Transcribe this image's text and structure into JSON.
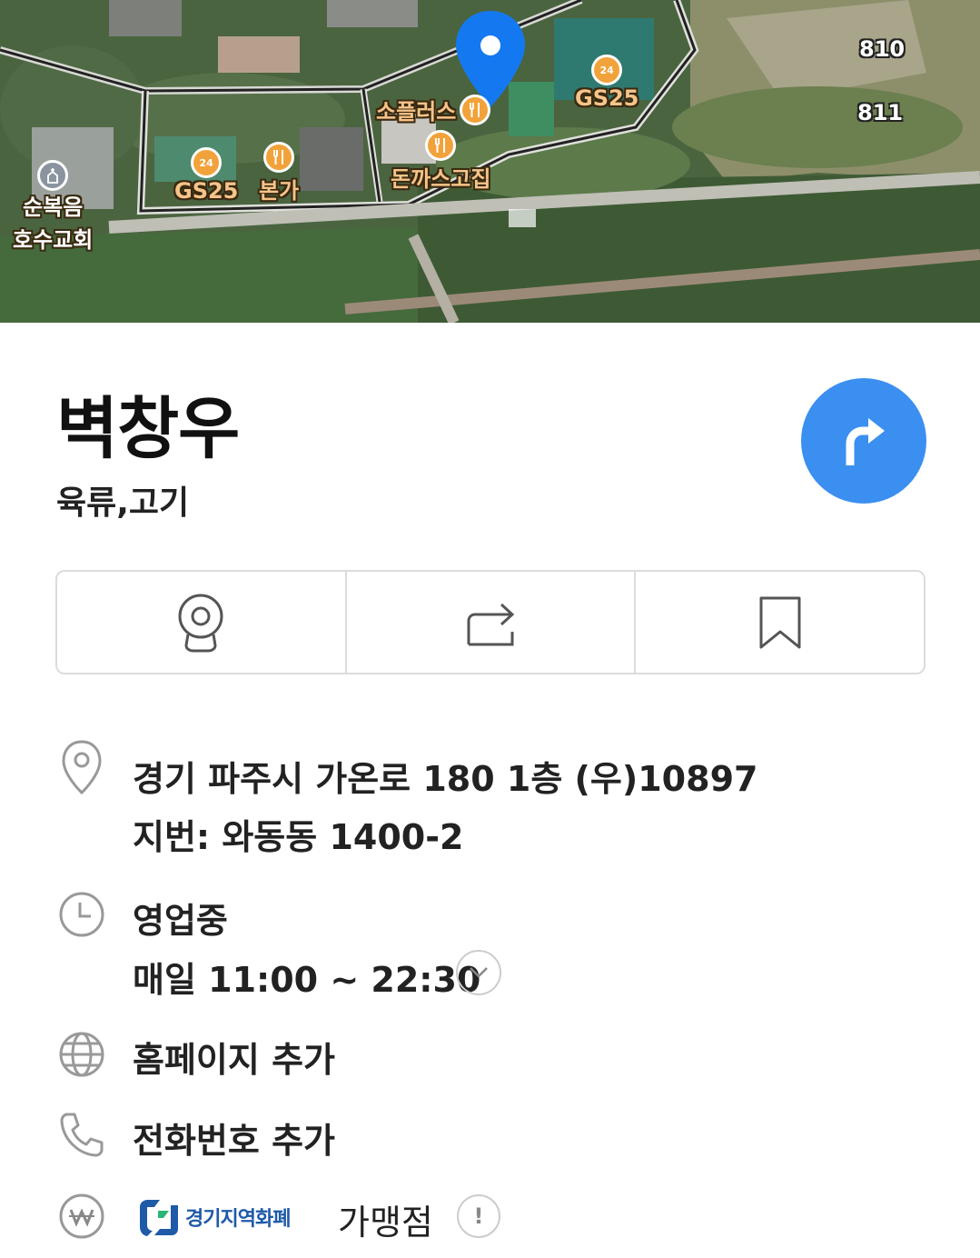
{
  "map": {
    "pois": [
      {
        "name": "소플러스",
        "icon": "restaurant-icon"
      },
      {
        "name": "GS25",
        "icon": "convenience-store-icon",
        "badge": "24"
      },
      {
        "name": "돈까스고집",
        "icon": "restaurant-icon"
      },
      {
        "name": "GS25",
        "icon": "convenience-store-icon",
        "badge": "24"
      },
      {
        "name": "본가",
        "icon": "restaurant-icon"
      },
      {
        "name": "순복음\n호수교회",
        "icon": "church-icon"
      }
    ],
    "road_numbers": [
      "810",
      "811"
    ]
  },
  "place": {
    "name": "벽창우",
    "category": "육류,고기"
  },
  "actions": {
    "items": [
      {
        "icon": "street-view-icon"
      },
      {
        "icon": "share-icon"
      },
      {
        "icon": "bookmark-icon"
      }
    ]
  },
  "info": {
    "address": "경기 파주시 가온로 180 1층 (우)10897",
    "lot_address": "지번: 와동동 1400-2",
    "status": "영업중",
    "hours": "매일 11:00 ~ 22:30",
    "homepage": "홈페이지 추가",
    "phone": "전화번호 추가",
    "badge_logo_text": "경기지역화폐",
    "badge_suffix": "가맹점",
    "notice_mark": "!"
  },
  "colors": {
    "accent": "#3b8ff0",
    "poi": "#f2a23a",
    "border": "#dcdcdc"
  }
}
